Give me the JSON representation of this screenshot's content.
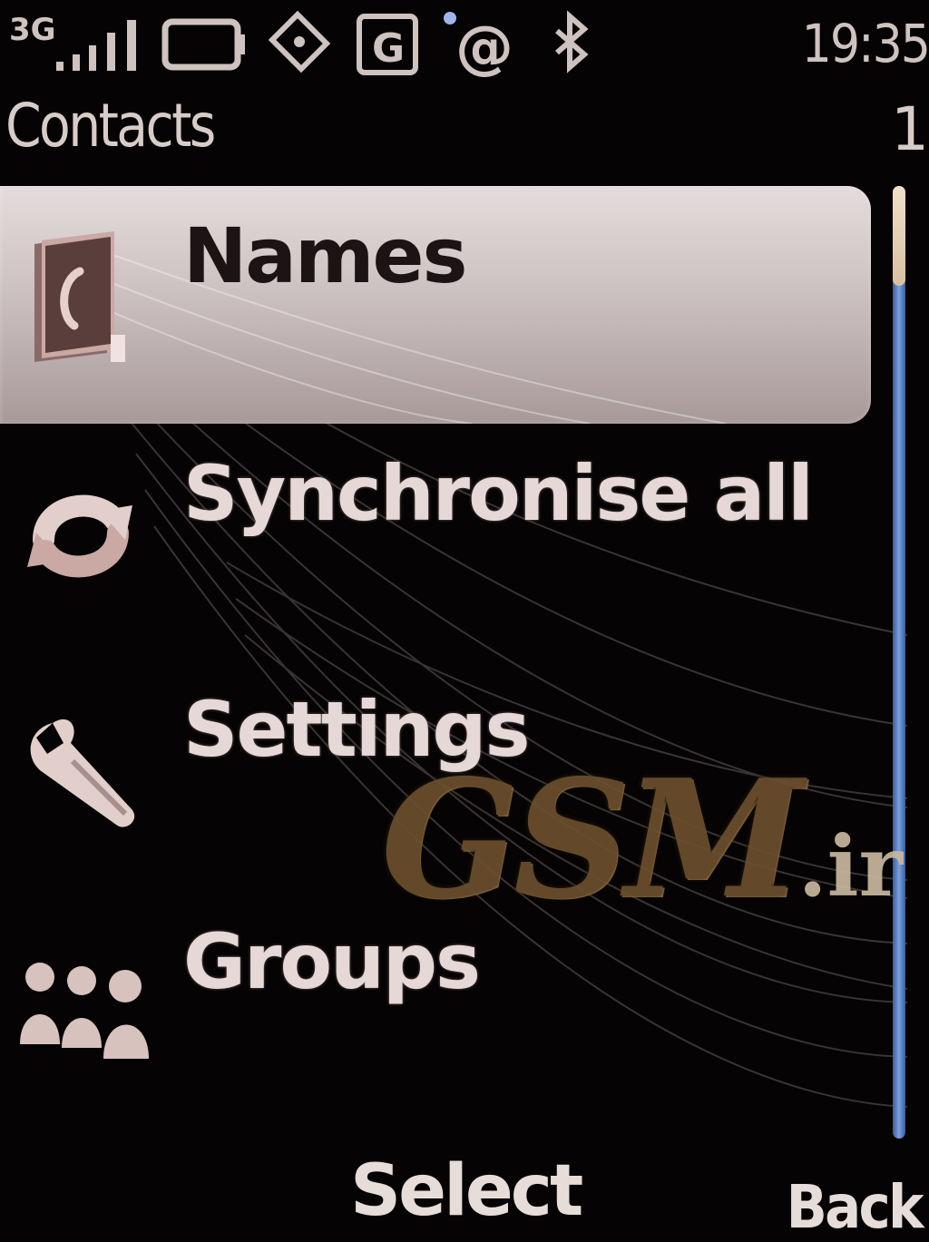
{
  "status_bar": {
    "network_type": "3G",
    "clock": "19:35",
    "icons": [
      "network-3g-icon",
      "signal-strength-icon",
      "battery-icon",
      "data-transfer-icon",
      "gprs-icon",
      "email-icon",
      "bluetooth-icon"
    ]
  },
  "header": {
    "title": "Contacts",
    "page_indicator": "1"
  },
  "menu": {
    "items": [
      {
        "label": "Names",
        "icon": "address-book-icon",
        "selected": true
      },
      {
        "label": "Synchronise all",
        "icon": "sync-icon",
        "selected": false
      },
      {
        "label": "Settings",
        "icon": "wrench-icon",
        "selected": false
      },
      {
        "label": "Groups",
        "icon": "people-group-icon",
        "selected": false
      }
    ]
  },
  "watermark": {
    "brand": "GSM",
    "suffix": ".ir"
  },
  "softkeys": {
    "left": "Select",
    "right": "Back"
  },
  "colors": {
    "background": "#050303",
    "selection": "#d8cfcf",
    "scrollbar": "#5a80c8",
    "watermark": "#6b4f2e"
  }
}
